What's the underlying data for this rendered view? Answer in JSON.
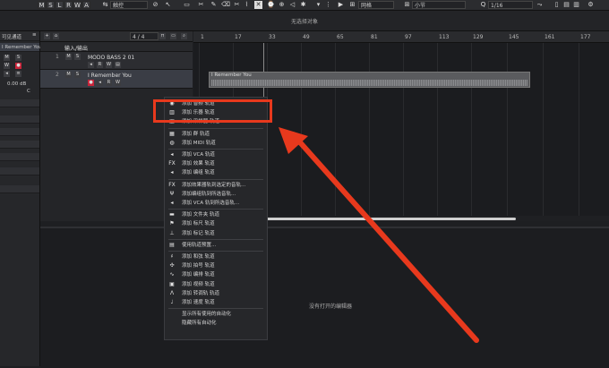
{
  "toolbar": {
    "mode_buttons": [
      "M",
      "S",
      "L",
      "R",
      "W",
      "A"
    ],
    "tool_label": "触控",
    "snap_label": "网格",
    "grid_label": "小节",
    "quantize_label": "1/16"
  },
  "selection_bar": {
    "text": "无选择对象"
  },
  "inspector": {
    "title": "可见通道",
    "track_name": "I Remember You",
    "volume": "0.00 dB",
    "pan": "C"
  },
  "tracklist": {
    "counter": "4 / 4",
    "tracks": [
      {
        "name": "输入/输出"
      },
      {
        "num": "1",
        "name": "MODO BASS 2 01"
      },
      {
        "num": "2",
        "name": "I Remember You"
      }
    ]
  },
  "ruler": {
    "marks": [
      "1",
      "17",
      "33",
      "49",
      "65",
      "81",
      "97",
      "113",
      "129",
      "145",
      "161",
      "177"
    ]
  },
  "clip": {
    "label": "I Remember You"
  },
  "lower_zone": {
    "message": "没有打开的编辑器"
  },
  "context_menu": {
    "items": [
      {
        "icon": "audio-track-icon",
        "glyph": "◉",
        "label": "添加 音频 轨道"
      },
      {
        "icon": "instrument-track-icon",
        "glyph": "▥",
        "label": "添加 乐器 轨道"
      },
      {
        "icon": "sampler-track-icon",
        "glyph": "◫",
        "label": "添加 采样器 轨道"
      },
      {
        "sep": true
      },
      {
        "icon": "group-track-icon",
        "glyph": "▦",
        "label": "添加 群 轨道"
      },
      {
        "icon": "midi-track-icon",
        "glyph": "◍",
        "label": "添加 MIDI 轨道"
      },
      {
        "sep": true
      },
      {
        "icon": "vca-track-icon",
        "glyph": "◂",
        "label": "添加 VCA 轨道"
      },
      {
        "icon": "fx-track-icon",
        "glyph": "FX",
        "label": "添加 效果 轨道"
      },
      {
        "icon": "bus-track-icon",
        "glyph": "◂",
        "label": "添加 编组 轨道"
      },
      {
        "sep": true
      },
      {
        "icon": "fx-send-icon",
        "glyph": "FX",
        "label": "添加效果器轨到选定的音轨..."
      },
      {
        "icon": "group-send-icon",
        "glyph": "Ψ",
        "label": "添加编组轨到所选音轨..."
      },
      {
        "icon": "vca-send-icon",
        "glyph": "◂",
        "label": "添加 VCA 轨到所选音轨..."
      },
      {
        "sep": true
      },
      {
        "icon": "folder-track-icon",
        "glyph": "▬",
        "label": "添加 文件夹 轨道"
      },
      {
        "icon": "marker-track-icon",
        "glyph": "⚑",
        "label": "添加 标尺 轨道"
      },
      {
        "icon": "ruler-track-icon",
        "glyph": "⊥",
        "label": "添加 标记 轨道"
      },
      {
        "sep": true
      },
      {
        "icon": "preset-icon",
        "glyph": "▤",
        "label": "使用轨道预置..."
      },
      {
        "sep": true
      },
      {
        "icon": "chord-track-icon",
        "glyph": "♯",
        "label": "添加 和弦 轨道"
      },
      {
        "icon": "beat-track-icon",
        "glyph": "✣",
        "label": "添加 拍号 轨道"
      },
      {
        "icon": "arranger-track-icon",
        "glyph": "∿",
        "label": "添加 编排 轨道"
      },
      {
        "icon": "video-track-icon",
        "glyph": "▣",
        "label": "添加 视频 轨道"
      },
      {
        "icon": "transpose-track-icon",
        "glyph": "Λ",
        "label": "添加 转调轨 轨道"
      },
      {
        "icon": "tempo-track-icon",
        "glyph": "♩",
        "label": "添加 速度 轨道"
      },
      {
        "sep": true
      },
      {
        "label": "显示所有使用的自动化"
      },
      {
        "label": "隐藏所有自动化"
      }
    ]
  },
  "colors": {
    "accent": "#e8391d",
    "record": "#c8243a",
    "background": "#1e1f22"
  }
}
